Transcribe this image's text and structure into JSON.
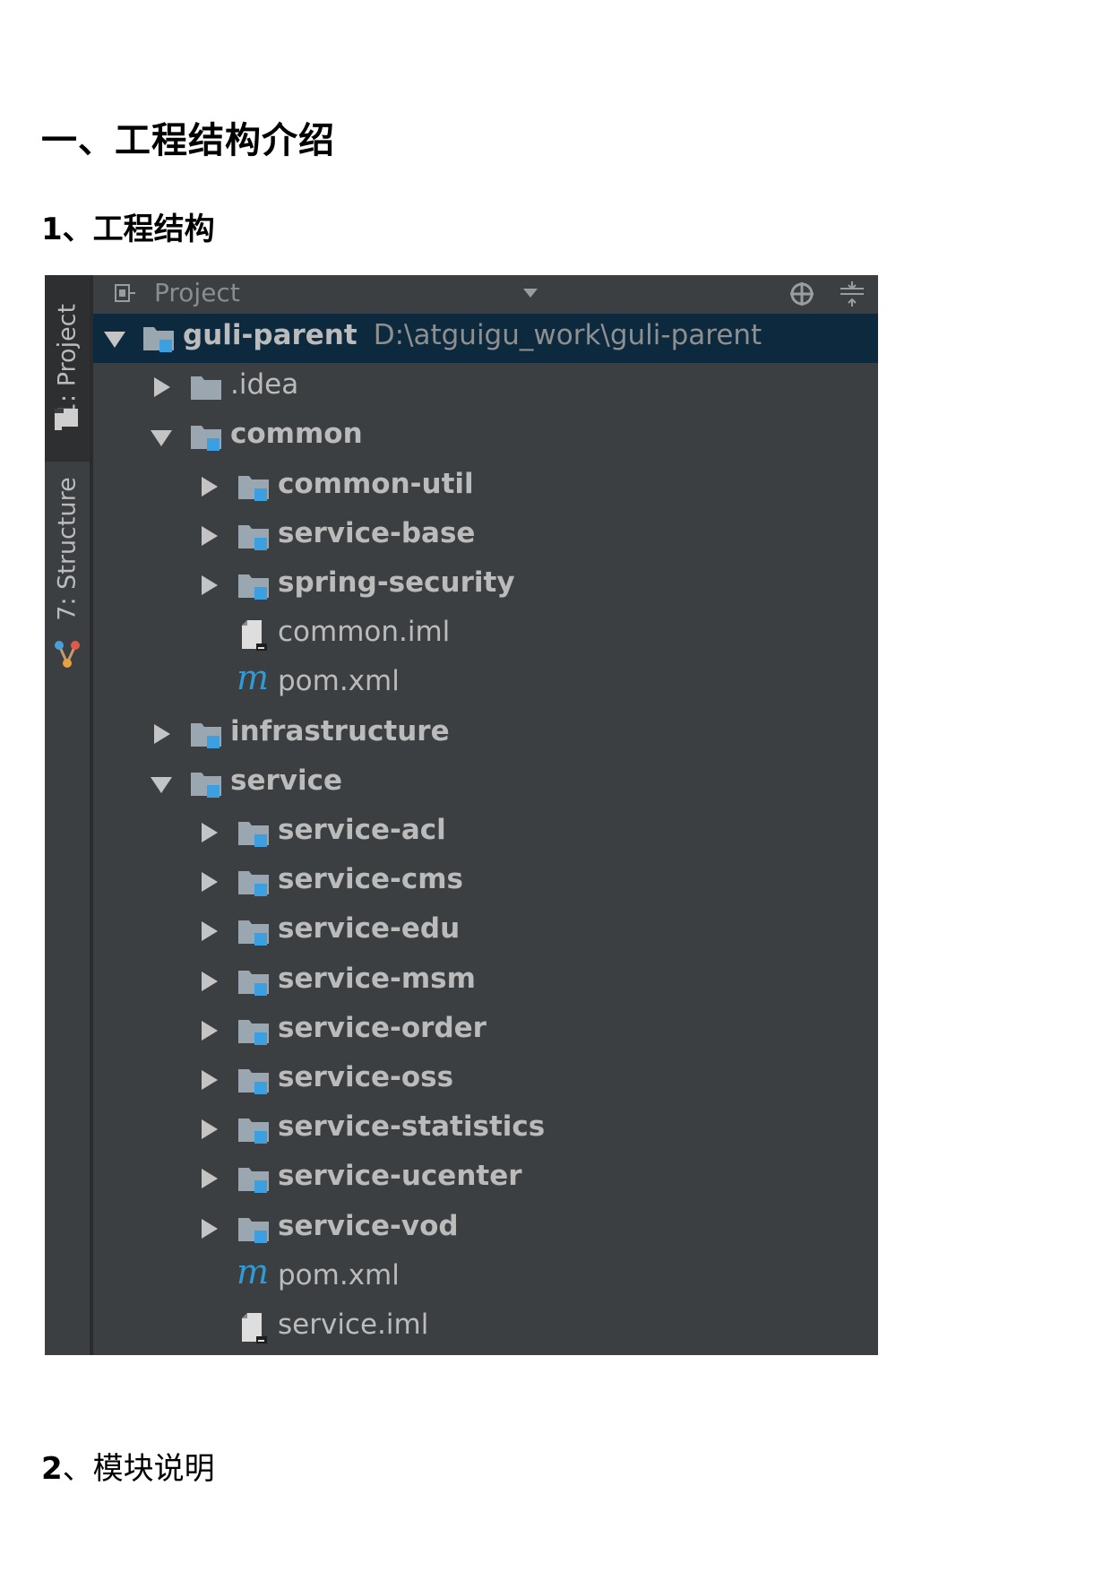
{
  "doc": {
    "title": "一、工程结构介绍",
    "section1": "1、工程结构",
    "section2_num": "2",
    "section2_text": "、模块说明"
  },
  "ide": {
    "stripe": {
      "project_tab": "1: Project",
      "structure_tab": "7: Structure"
    },
    "toolbar": {
      "title": "Project"
    },
    "tree": [
      {
        "label": "guli-parent",
        "path": "D:\\atguigu_work\\guli-parent",
        "depth": 0,
        "arrow": "down",
        "icon": "module-folder",
        "bold": true,
        "selected": true
      },
      {
        "label": ".idea",
        "depth": 1,
        "arrow": "right",
        "icon": "folder",
        "bold": false
      },
      {
        "label": "common",
        "depth": 1,
        "arrow": "down",
        "icon": "module-folder",
        "bold": true
      },
      {
        "label": "common-util",
        "depth": 2,
        "arrow": "right",
        "icon": "module-folder",
        "bold": true
      },
      {
        "label": "service-base",
        "depth": 2,
        "arrow": "right",
        "icon": "module-folder",
        "bold": true
      },
      {
        "label": "spring-security",
        "depth": 2,
        "arrow": "right",
        "icon": "module-folder",
        "bold": true
      },
      {
        "label": "common.iml",
        "depth": 2,
        "arrow": "none",
        "icon": "iml-file",
        "bold": false
      },
      {
        "label": "pom.xml",
        "depth": 2,
        "arrow": "none",
        "icon": "maven-file",
        "bold": false
      },
      {
        "label": "infrastructure",
        "depth": 1,
        "arrow": "right",
        "icon": "module-folder",
        "bold": true
      },
      {
        "label": "service",
        "depth": 1,
        "arrow": "down",
        "icon": "module-folder",
        "bold": true
      },
      {
        "label": "service-acl",
        "depth": 2,
        "arrow": "right",
        "icon": "module-folder",
        "bold": true
      },
      {
        "label": "service-cms",
        "depth": 2,
        "arrow": "right",
        "icon": "module-folder",
        "bold": true
      },
      {
        "label": "service-edu",
        "depth": 2,
        "arrow": "right",
        "icon": "module-folder",
        "bold": true
      },
      {
        "label": "service-msm",
        "depth": 2,
        "arrow": "right",
        "icon": "module-folder",
        "bold": true
      },
      {
        "label": "service-order",
        "depth": 2,
        "arrow": "right",
        "icon": "module-folder",
        "bold": true
      },
      {
        "label": "service-oss",
        "depth": 2,
        "arrow": "right",
        "icon": "module-folder",
        "bold": true
      },
      {
        "label": "service-statistics",
        "depth": 2,
        "arrow": "right",
        "icon": "module-folder",
        "bold": true
      },
      {
        "label": "service-ucenter",
        "depth": 2,
        "arrow": "right",
        "icon": "module-folder",
        "bold": true
      },
      {
        "label": "service-vod",
        "depth": 2,
        "arrow": "right",
        "icon": "module-folder",
        "bold": true
      },
      {
        "label": "pom.xml",
        "depth": 2,
        "arrow": "none",
        "icon": "maven-file",
        "bold": false
      },
      {
        "label": "service.iml",
        "depth": 2,
        "arrow": "none",
        "icon": "iml-file",
        "bold": false
      }
    ]
  },
  "colors": {
    "panel_bg": "#3c3f41",
    "selection_bg": "#0d293e",
    "module_badge": "#3ca0e0",
    "text": "#bbbbbb"
  }
}
